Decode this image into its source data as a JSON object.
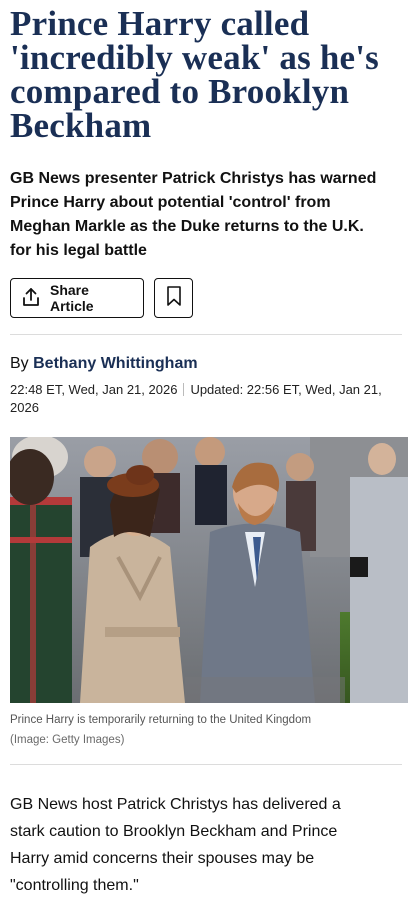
{
  "article": {
    "headline_lines": [
      "Prince Harry called",
      "'incredibly weak' as he's",
      "compared to Brooklyn",
      "Beckham"
    ],
    "standfirst_lines": [
      "GB News presenter Patrick Christys has warned",
      "Prince Harry about potential 'control' from",
      "Meghan Markle as the Duke returns to the U.K.",
      "for his legal battle"
    ],
    "share_label": "Share Article",
    "byline_prefix": "By",
    "author": "Bethany Whittingham",
    "published": "22:48 ET, Wed, Jan 21, 2026",
    "updated": "Updated: 22:56 ET, Wed, Jan 21,",
    "updated_cont": "2026",
    "caption": "Prince Harry is temporarily returning to the United Kingdom",
    "credit": "(Image: Getty Images)",
    "body_lines": [
      "GB News host Patrick Christys has delivered a",
      "stark caution to Brooklyn Beckham and Prince",
      "Harry amid concerns their spouses may be",
      "\"controlling them.\""
    ]
  },
  "icons": {
    "share": "share-icon",
    "bookmark": "bookmark-icon"
  },
  "colors": {
    "headline": "#1a2f55",
    "author": "#1a2f55"
  }
}
